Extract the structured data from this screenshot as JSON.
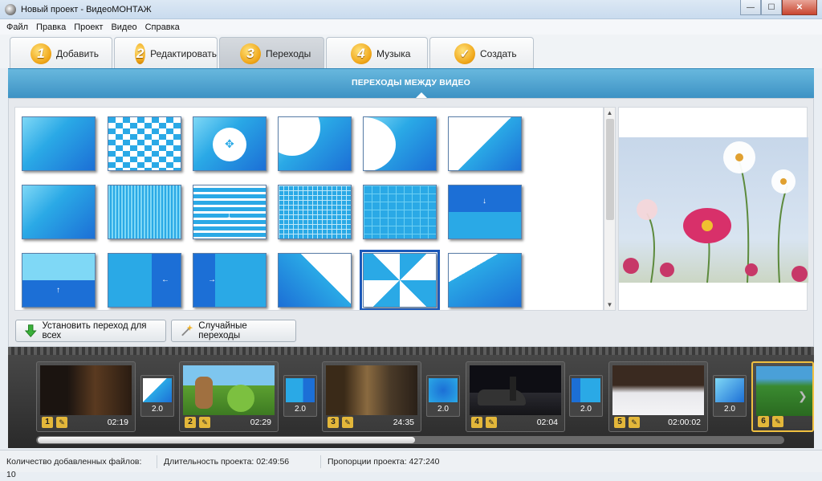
{
  "window": {
    "title": "Новый проект - ВидеоМОНТАЖ",
    "minimize": "—",
    "maximize": "☐",
    "close": "✕"
  },
  "menu": [
    "Файл",
    "Правка",
    "Проект",
    "Видео",
    "Справка"
  ],
  "tabs": [
    {
      "num": "1",
      "label": "Добавить"
    },
    {
      "num": "2",
      "label": "Редактировать"
    },
    {
      "num": "3",
      "label": "Переходы",
      "active": true
    },
    {
      "num": "4",
      "label": "Музыка"
    },
    {
      "num": "✓",
      "label": "Создать"
    }
  ],
  "banner": {
    "title": "ПЕРЕХОДЫ МЕЖДУ ВИДЕО"
  },
  "transitions_grid": {
    "selected_index": 16,
    "rows": 3,
    "cols": 6
  },
  "buttons": {
    "apply_all": "Установить переход для всех",
    "random": "Случайные переходы"
  },
  "timeline": {
    "clips": [
      {
        "num": "1",
        "duration": "02:19"
      },
      {
        "num": "2",
        "duration": "02:29"
      },
      {
        "num": "3",
        "duration": "24:35"
      },
      {
        "num": "4",
        "duration": "02:04"
      },
      {
        "num": "5",
        "duration": "02:00:02"
      },
      {
        "num": "6",
        "duration": ""
      }
    ],
    "transitions": [
      "2.0",
      "2.0",
      "2.0",
      "2.0",
      "2.0"
    ]
  },
  "status": {
    "files": "Количество добавленных файлов: 10",
    "duration": "Длительность проекта:  02:49:56",
    "ratio": "Пропорции проекта:  427:240"
  },
  "colors": {
    "accent": "#3d92c4",
    "tab_badge": "#f0a71a",
    "selection": "#1b58b8"
  }
}
